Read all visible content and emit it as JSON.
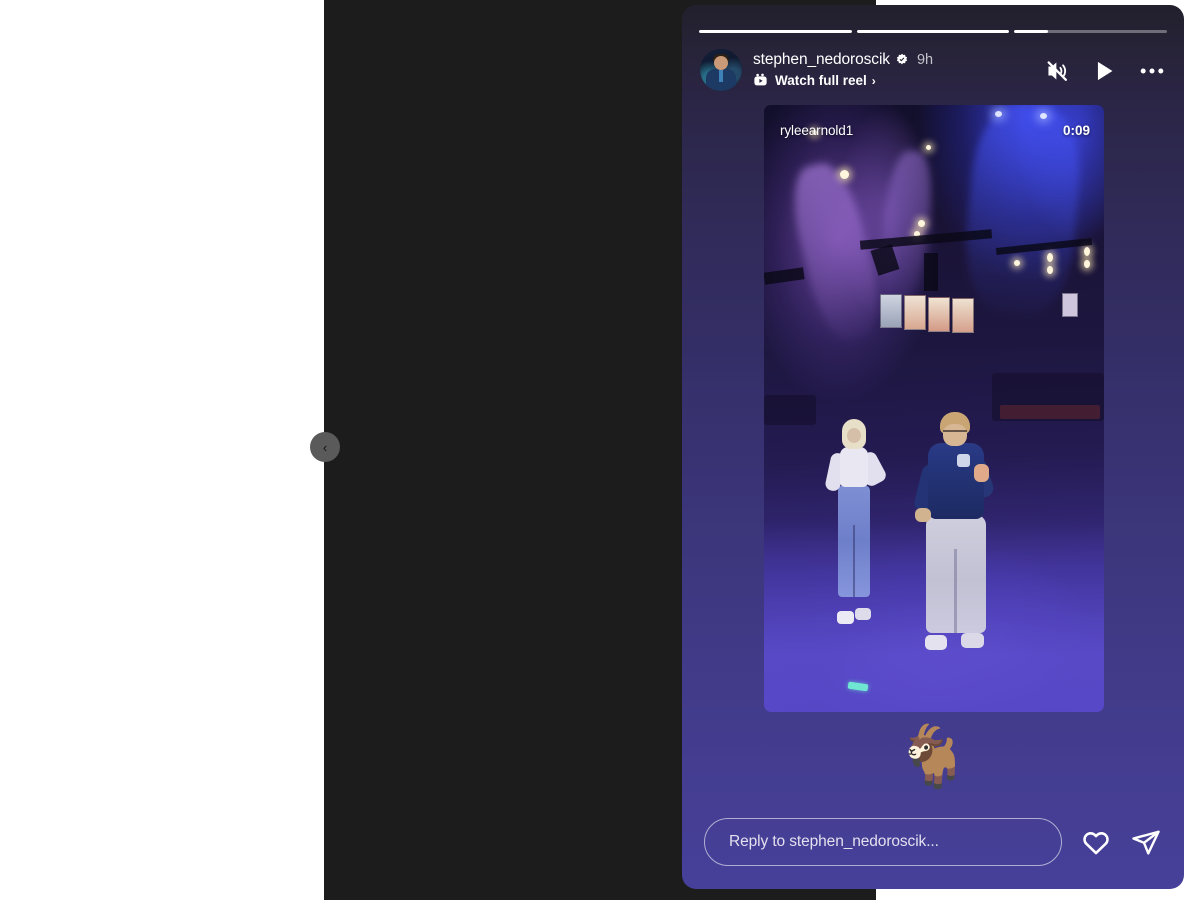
{
  "viewer": {
    "prev_story_button_label": "‹",
    "backdrop_color": "#1c1c1c",
    "page_background": "#ffffff"
  },
  "story": {
    "background_top_color": "#21202c",
    "background_bottom_color": "#47409a",
    "progress": {
      "segment_count": 3,
      "segments": [
        {
          "name": "segment-1",
          "fill_percent": 100
        },
        {
          "name": "segment-2",
          "fill_percent": 100
        },
        {
          "name": "segment-3",
          "fill_percent": 22
        }
      ]
    },
    "header": {
      "username": "stephen_nedoroscik",
      "verified": true,
      "verified_icon": "verified-badge-icon",
      "timestamp": "9h",
      "watch_reel_label": "Watch full reel",
      "watch_reel_chevron": "›",
      "reels_icon": "reels-icon",
      "avatar_icon": "avatar",
      "actions": [
        {
          "name": "mute-button",
          "icon": "speaker-muted-icon"
        },
        {
          "name": "play-button",
          "icon": "play-icon"
        },
        {
          "name": "more-options-button",
          "icon": "more-horizontal-icon"
        }
      ]
    },
    "video": {
      "username": "ryleearnold1",
      "duration": "0:09",
      "scene_description": "two dancers on a dark theater stage under purple and blue stage lights"
    },
    "sticker": {
      "emoji": "🐐",
      "name": "goat-emoji"
    },
    "reply": {
      "placeholder": "Reply to stephen_nedoroscik...",
      "value": "",
      "like_icon": "heart-icon",
      "share_icon": "paper-plane-icon"
    }
  }
}
